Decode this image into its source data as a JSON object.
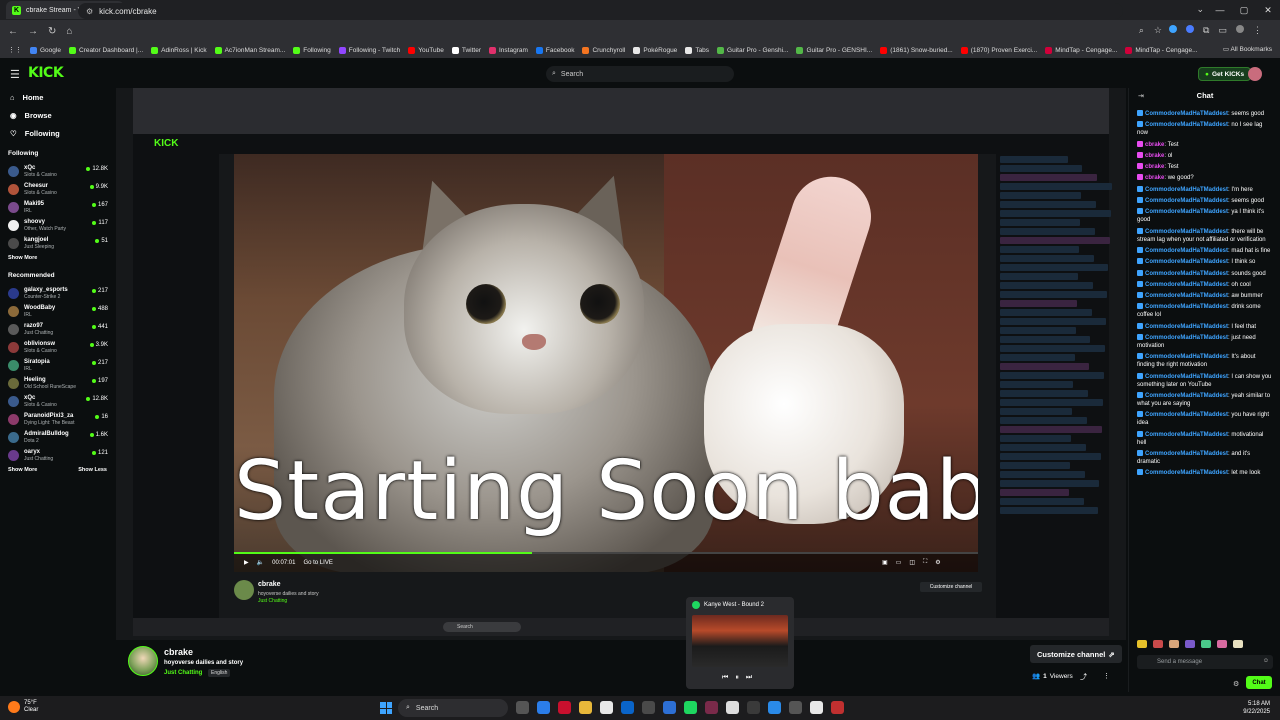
{
  "browser": {
    "tab_title": "cbrake Stream - Watch Live",
    "tab_close": "✕",
    "new_tab": "+",
    "url": "kick.com/cbrake",
    "bookmarks": [
      {
        "label": "Google",
        "color": "#4285f4"
      },
      {
        "label": "Creator Dashboard |...",
        "color": "#53fc18"
      },
      {
        "label": "AdinRoss | Kick",
        "color": "#53fc18"
      },
      {
        "label": "Ac7ionMan Stream...",
        "color": "#53fc18"
      },
      {
        "label": "Following",
        "color": "#53fc18"
      },
      {
        "label": "Following - Twitch",
        "color": "#9146ff"
      },
      {
        "label": "YouTube",
        "color": "#ff0000"
      },
      {
        "label": "Twitter",
        "color": "#ffffff"
      },
      {
        "label": "Instagram",
        "color": "#e1306c"
      },
      {
        "label": "Facebook",
        "color": "#1877f2"
      },
      {
        "label": "Crunchyroll",
        "color": "#f47521"
      },
      {
        "label": "PokéRogue",
        "color": "#e8e8e8"
      },
      {
        "label": "Tabs",
        "color": "#e8e8e8"
      },
      {
        "label": "Guitar Pro - Genshi...",
        "color": "#53b848"
      },
      {
        "label": "Guitar Pro - GENSHI...",
        "color": "#53b848"
      },
      {
        "label": "(1861) Snow-buried...",
        "color": "#ff0000"
      },
      {
        "label": "(1870) Proven Exerci...",
        "color": "#ff0000"
      },
      {
        "label": "MindTap - Cengage...",
        "color": "#d1003a"
      },
      {
        "label": "MindTap - Cengage...",
        "color": "#d1003a"
      }
    ],
    "all_bookmarks": "All Bookmarks"
  },
  "kick": {
    "logo": "KICK",
    "search_placeholder": "Search",
    "get_kicks": "Get KICKs"
  },
  "sidebar": {
    "nav": [
      {
        "label": "Home",
        "icon": "home-icon"
      },
      {
        "label": "Browse",
        "icon": "browse-icon"
      },
      {
        "label": "Following",
        "icon": "heart-icon"
      }
    ],
    "following_header": "Following",
    "following": [
      {
        "name": "xQc",
        "category": "Slots & Casino",
        "viewers": "12.8K",
        "color": "#3a5a8c"
      },
      {
        "name": "Cheesur",
        "category": "Slots & Casino",
        "viewers": "9.9K",
        "color": "#b0533a"
      },
      {
        "name": "Maki95",
        "category": "IRL",
        "viewers": "167",
        "color": "#7a4a8c"
      },
      {
        "name": "shoovy",
        "category": "Other, Watch Party",
        "viewers": "117",
        "color": "#f0f0f0"
      },
      {
        "name": "kangjoel",
        "category": "Just Sleeping",
        "viewers": "51",
        "color": "#4a4a4a"
      }
    ],
    "show_more": "Show More",
    "recommended_header": "Recommended",
    "recommended": [
      {
        "name": "galaxy_esports",
        "category": "Counter-Strike 2",
        "viewers": "217",
        "color": "#2a3a8c"
      },
      {
        "name": "WoodBaby",
        "category": "IRL",
        "viewers": "488",
        "color": "#8c6a3a"
      },
      {
        "name": "razo97",
        "category": "Just Chatting",
        "viewers": "441",
        "color": "#5a5a5a"
      },
      {
        "name": "oblivionsw",
        "category": "Slots & Casino",
        "viewers": "3.9K",
        "color": "#8c3a3a"
      },
      {
        "name": "Siratopia",
        "category": "IRL",
        "viewers": "217",
        "color": "#3a8c6a"
      },
      {
        "name": "Heeling",
        "category": "Old School RuneScape",
        "viewers": "197",
        "color": "#6a6a3a"
      },
      {
        "name": "xQc",
        "category": "Slots & Casino",
        "viewers": "12.8K",
        "color": "#3a5a8c"
      },
      {
        "name": "ParanoidPixi3_za",
        "category": "Dying Light: The Beast",
        "viewers": "16",
        "color": "#8c3a6a"
      },
      {
        "name": "AdmiralBulldog",
        "category": "Dota 2",
        "viewers": "1.6K",
        "color": "#3a6a8c"
      },
      {
        "name": "oaryx",
        "category": "Just Chatting",
        "viewers": "121",
        "color": "#6a3a8c"
      }
    ],
    "show_more_2": "Show More",
    "show_less": "Show Less"
  },
  "stream": {
    "overlay_text": "Starting Soon babe",
    "progress_fraction": 0.4,
    "inner_time": "00:07:01",
    "inner_golive": "Go to LIVE",
    "inner_search": "Search"
  },
  "channel": {
    "name": "cbrake",
    "title": "hoyoverse dailies and story",
    "category": "Just Chatting",
    "language": "English",
    "customize_button": "Customize channel",
    "viewers_count": "1",
    "viewers_label": "Viewers"
  },
  "spotify": {
    "now_playing": "Kanye West - Bound 2"
  },
  "chat": {
    "title": "Chat",
    "messages": [
      {
        "user": "CommodoreMadHaTMaddest",
        "text": "seems good",
        "color": "#3ea4ff",
        "badge": "#3ea4ff"
      },
      {
        "user": "CommodoreMadHaTMaddest",
        "text": "no I see lag now",
        "color": "#3ea4ff",
        "badge": "#3ea4ff"
      },
      {
        "user": "cbrake",
        "text": "Test",
        "color": "#e84cf0",
        "badge": "#e84cf0"
      },
      {
        "user": "cbrake",
        "text": "ol",
        "color": "#e84cf0",
        "badge": "#e84cf0"
      },
      {
        "user": "cbrake",
        "text": "Test",
        "color": "#e84cf0",
        "badge": "#e84cf0"
      },
      {
        "user": "cbrake",
        "text": "we good?",
        "color": "#e84cf0",
        "badge": "#e84cf0"
      },
      {
        "user": "CommodoreMadHaTMaddest",
        "text": "I'm here",
        "color": "#3ea4ff",
        "badge": "#3ea4ff"
      },
      {
        "user": "CommodoreMadHaTMaddest",
        "text": "seems good",
        "color": "#3ea4ff",
        "badge": "#3ea4ff"
      },
      {
        "user": "CommodoreMadHaTMaddest",
        "text": "ya I think it's good",
        "color": "#3ea4ff",
        "badge": "#3ea4ff"
      },
      {
        "user": "CommodoreMadHaTMaddest",
        "text": "there will be stream lag when your not affiliated or verification",
        "color": "#3ea4ff",
        "badge": "#3ea4ff"
      },
      {
        "user": "CommodoreMadHaTMaddest",
        "text": "mad hat is fine",
        "color": "#3ea4ff",
        "badge": "#3ea4ff"
      },
      {
        "user": "CommodoreMadHaTMaddest",
        "text": "I think so",
        "color": "#3ea4ff",
        "badge": "#3ea4ff"
      },
      {
        "user": "CommodoreMadHaTMaddest",
        "text": "sounds good",
        "color": "#3ea4ff",
        "badge": "#3ea4ff"
      },
      {
        "user": "CommodoreMadHaTMaddest",
        "text": "oh cool",
        "color": "#3ea4ff",
        "badge": "#3ea4ff"
      },
      {
        "user": "CommodoreMadHaTMaddest",
        "text": "aw bummer",
        "color": "#3ea4ff",
        "badge": "#3ea4ff"
      },
      {
        "user": "CommodoreMadHaTMaddest",
        "text": "drink some coffee lol",
        "color": "#3ea4ff",
        "badge": "#3ea4ff"
      },
      {
        "user": "CommodoreMadHaTMaddest",
        "text": "I feel that",
        "color": "#3ea4ff",
        "badge": "#3ea4ff"
      },
      {
        "user": "CommodoreMadHaTMaddest",
        "text": "just need motivation",
        "color": "#3ea4ff",
        "badge": "#3ea4ff"
      },
      {
        "user": "CommodoreMadHaTMaddest",
        "text": "It's about finding the right motivation",
        "color": "#3ea4ff",
        "badge": "#3ea4ff"
      },
      {
        "user": "CommodoreMadHaTMaddest",
        "text": "I can show you something later on YouTube",
        "color": "#3ea4ff",
        "badge": "#3ea4ff"
      },
      {
        "user": "CommodoreMadHaTMaddest",
        "text": "yeah similar to what you are saying",
        "color": "#3ea4ff",
        "badge": "#3ea4ff"
      },
      {
        "user": "CommodoreMadHaTMaddest",
        "text": "you have right idea",
        "color": "#3ea4ff",
        "badge": "#3ea4ff"
      },
      {
        "user": "CommodoreMadHaTMaddest",
        "text": "motivational hell",
        "color": "#3ea4ff",
        "badge": "#3ea4ff"
      },
      {
        "user": "CommodoreMadHaTMaddest",
        "text": "and it's dramatic",
        "color": "#3ea4ff",
        "badge": "#3ea4ff"
      },
      {
        "user": "CommodoreMadHaTMaddest",
        "text": "let me look",
        "color": "#3ea4ff",
        "badge": "#3ea4ff"
      }
    ],
    "input_placeholder": "Send a message",
    "send_button": "Chat"
  },
  "taskbar": {
    "weather_temp": "75°F",
    "weather_desc": "Clear",
    "search": "Search",
    "time": "5:18 AM",
    "date": "9/22/2025"
  }
}
